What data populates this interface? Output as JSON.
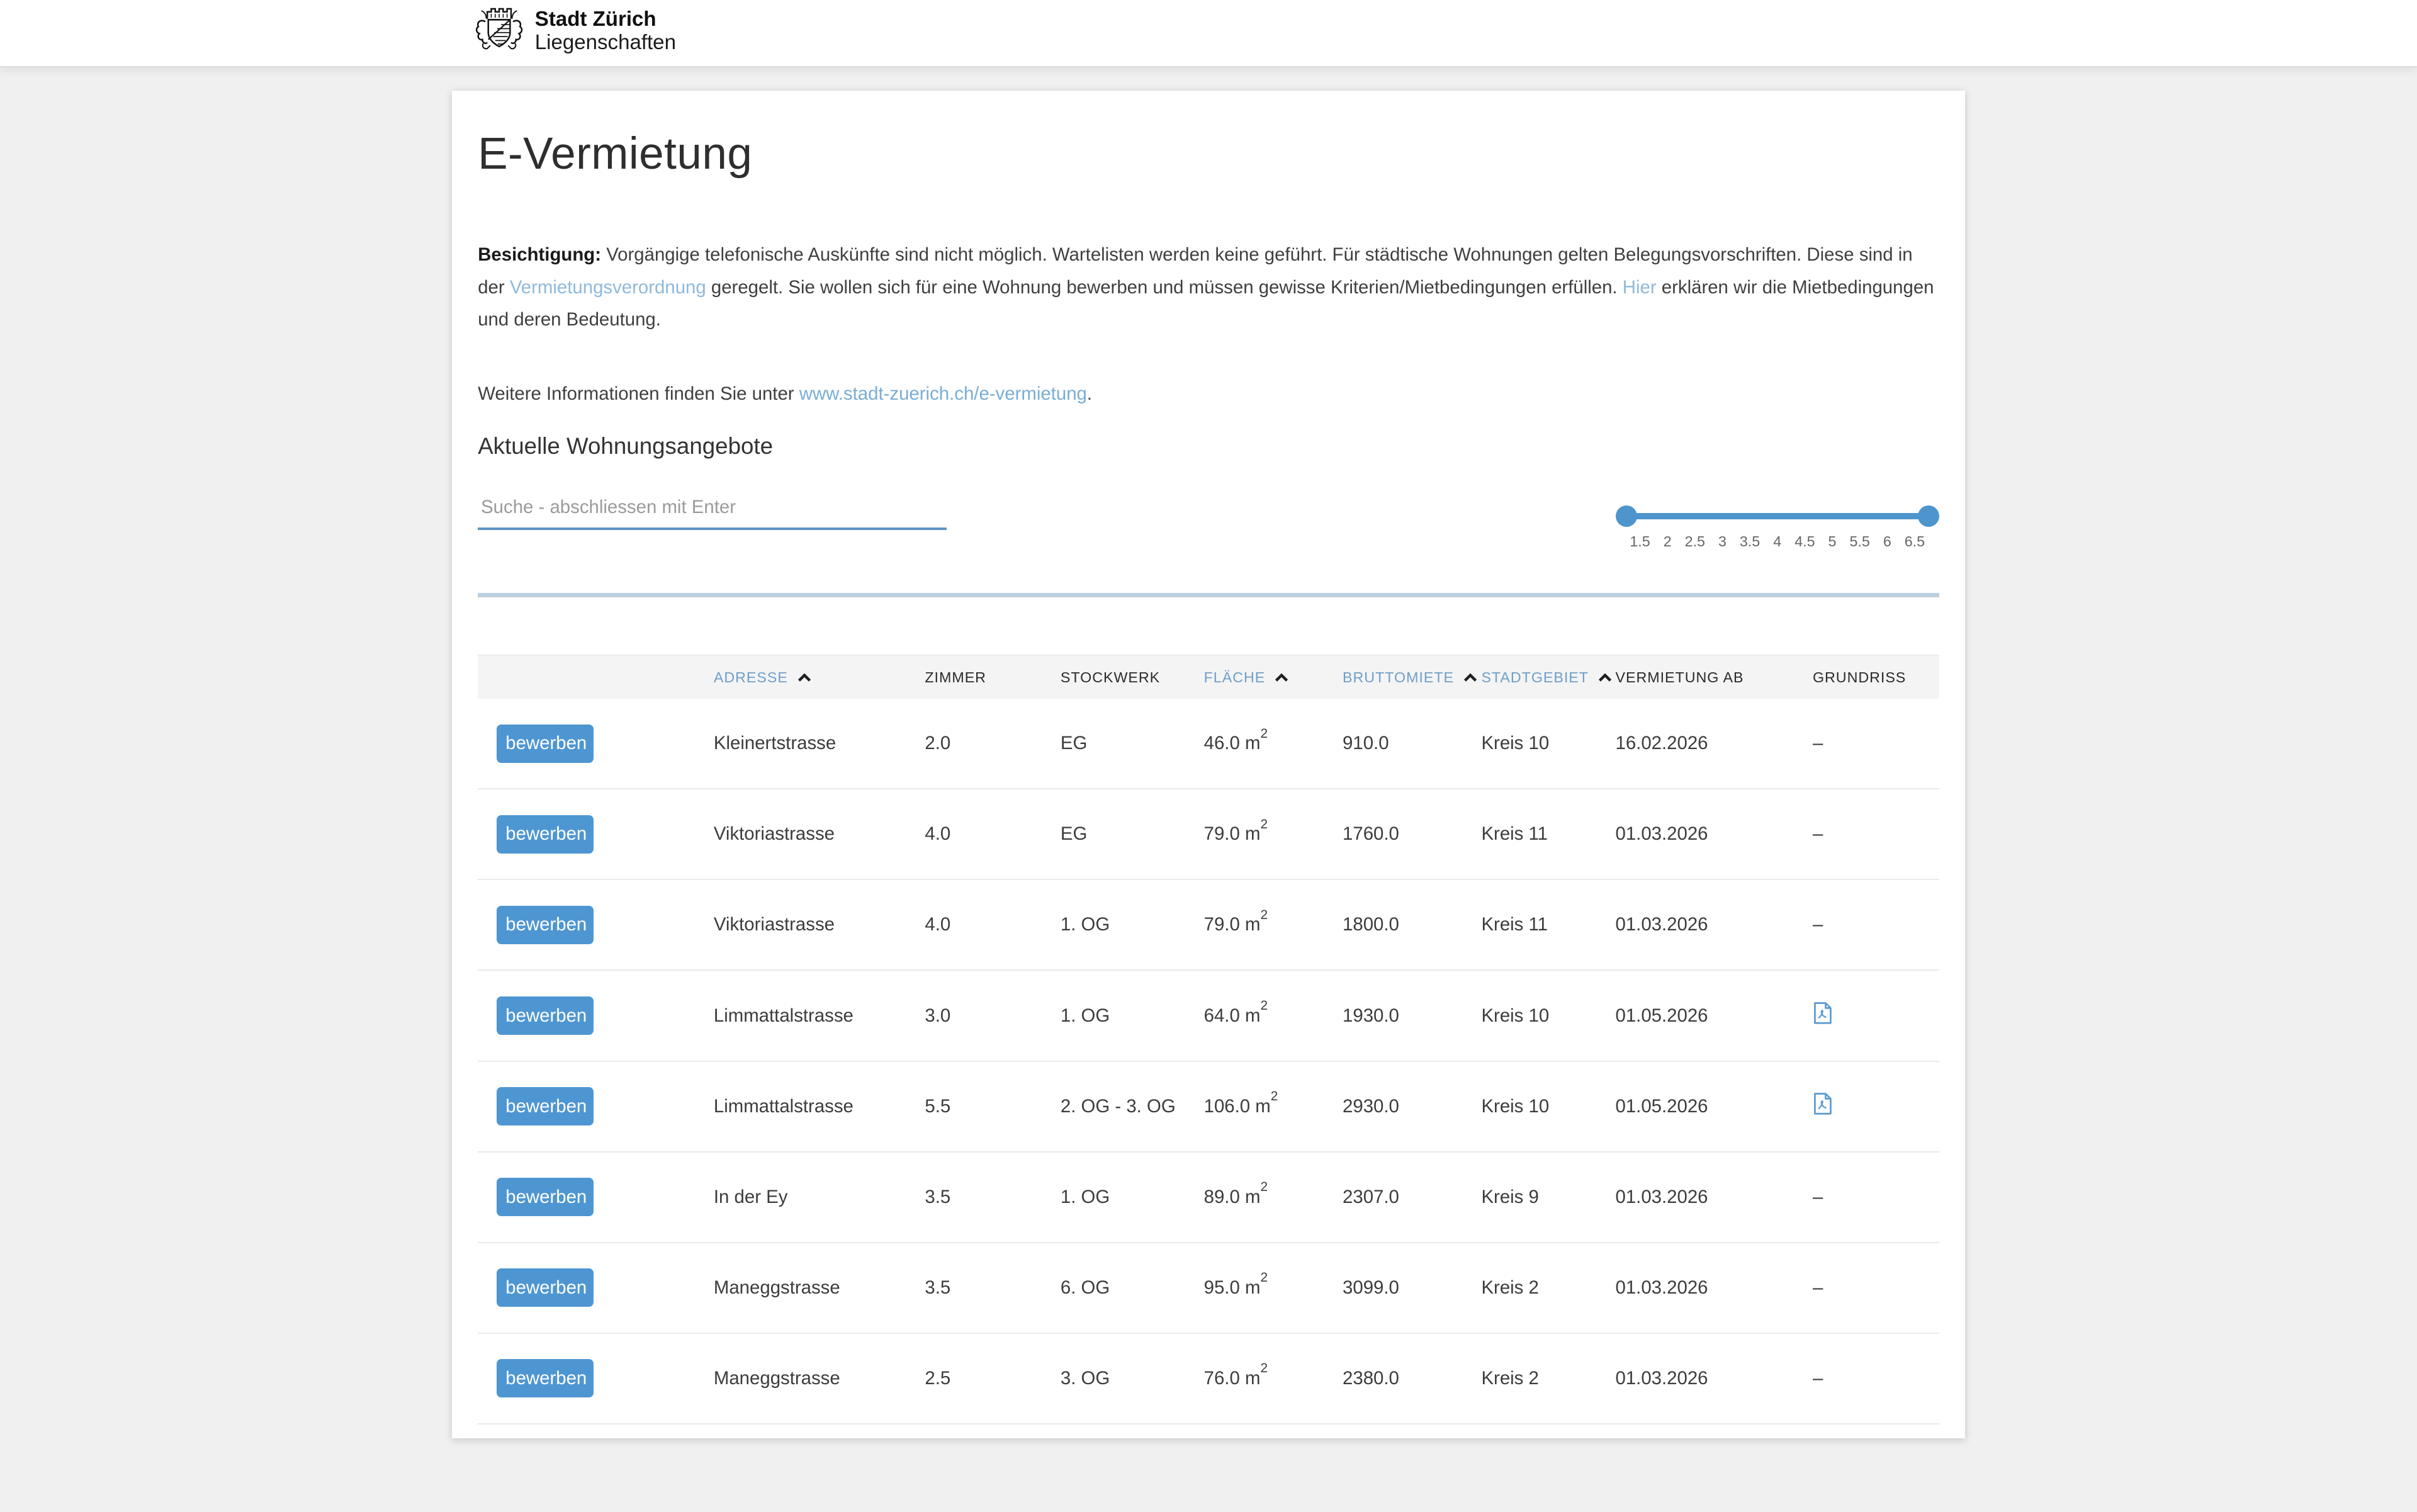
{
  "header": {
    "brand_title": "Stadt Zürich",
    "brand_subtitle": "Liegenschaften"
  },
  "page": {
    "title": "E-Vermietung",
    "intro": {
      "label": "Besichtigung:",
      "text_1": " Vorgängige telefonische Auskünfte sind nicht möglich. Wartelisten werden keine geführt. Für städtische Wohnungen gelten Belegungsvorschriften. Diese sind in der ",
      "link_1": "Vermietungsverordnung",
      "text_2": " geregelt. Sie wollen sich für eine Wohnung bewerben und müssen gewisse Kriterien/Mietbedingungen erfüllen. ",
      "link_2": "Hier",
      "text_3": " erklären wir die Mietbedingungen und deren Bedeutung."
    },
    "more_info": {
      "text": "Weitere Informationen finden Sie unter ",
      "link": "www.stadt-zuerich.ch/e-vermietung",
      "suffix": "."
    },
    "section_title": "Aktuelle Wohnungsangebote",
    "search_placeholder": "Suche - abschliessen mit Enter",
    "slider": {
      "min_value": "1.5",
      "max_value": "6.5",
      "labels": [
        "1.5",
        "2",
        "2.5",
        "3",
        "3.5",
        "4",
        "4.5",
        "5",
        "5.5",
        "6",
        "6.5"
      ]
    }
  },
  "table": {
    "apply_label": "bewerben",
    "columns": [
      {
        "label": "ADRESSE",
        "sortable": true
      },
      {
        "label": "ZIMMER",
        "sortable": false
      },
      {
        "label": "STOCKWERK",
        "sortable": false
      },
      {
        "label": "FLÄCHE",
        "sortable": true
      },
      {
        "label": "BRUTTOMIETE",
        "sortable": true
      },
      {
        "label": "STADTGEBIET",
        "sortable": true
      },
      {
        "label": "VERMIETUNG AB",
        "sortable": false
      },
      {
        "label": "GRUNDRISS",
        "sortable": false
      }
    ],
    "rows": [
      {
        "adresse": "Kleinertstrasse",
        "zimmer": "2.0",
        "stockwerk": "EG",
        "flaeche": "46.0 m²",
        "bruttomiete": "910.0",
        "stadtgebiet": "Kreis 10",
        "vermietung_ab": "16.02.2026",
        "grundriss": "–"
      },
      {
        "adresse": "Viktoriastrasse",
        "zimmer": "4.0",
        "stockwerk": "EG",
        "flaeche": "79.0 m²",
        "bruttomiete": "1760.0",
        "stadtgebiet": "Kreis 11",
        "vermietung_ab": "01.03.2026",
        "grundriss": "–"
      },
      {
        "adresse": "Viktoriastrasse",
        "zimmer": "4.0",
        "stockwerk": "1. OG",
        "flaeche": "79.0 m²",
        "bruttomiete": "1800.0",
        "stadtgebiet": "Kreis 11",
        "vermietung_ab": "01.03.2026",
        "grundriss": "–"
      },
      {
        "adresse": "Limmattalstrasse",
        "zimmer": "3.0",
        "stockwerk": "1. OG",
        "flaeche": "64.0 m²",
        "bruttomiete": "1930.0",
        "stadtgebiet": "Kreis 10",
        "vermietung_ab": "01.05.2026",
        "grundriss": "pdf"
      },
      {
        "adresse": "Limmattalstrasse",
        "zimmer": "5.5",
        "stockwerk": "2. OG - 3. OG",
        "flaeche": "106.0 m²",
        "bruttomiete": "2930.0",
        "stadtgebiet": "Kreis 10",
        "vermietung_ab": "01.05.2026",
        "grundriss": "pdf"
      },
      {
        "adresse": "In der Ey",
        "zimmer": "3.5",
        "stockwerk": "1. OG",
        "flaeche": "89.0 m²",
        "bruttomiete": "2307.0",
        "stadtgebiet": "Kreis 9",
        "vermietung_ab": "01.03.2026",
        "grundriss": "–"
      },
      {
        "adresse": "Maneggstrasse",
        "zimmer": "3.5",
        "stockwerk": "6. OG",
        "flaeche": "95.0 m²",
        "bruttomiete": "3099.0",
        "stadtgebiet": "Kreis 2",
        "vermietung_ab": "01.03.2026",
        "grundriss": "–"
      },
      {
        "adresse": "Maneggstrasse",
        "zimmer": "2.5",
        "stockwerk": "3. OG",
        "flaeche": "76.0 m²",
        "bruttomiete": "2380.0",
        "stadtgebiet": "Kreis 2",
        "vermietung_ab": "01.03.2026",
        "grundriss": "–"
      }
    ]
  },
  "colors": {
    "accent_blue": "#4e96d2",
    "slider_blue": "#4e95cd",
    "input_underline_blue": "#5b94c2",
    "link_light_blue": "#8fb9dd",
    "link_url_blue": "#79add5",
    "sort_header_blue": "#6f9fc9",
    "divider_blue": "#b9d0e3",
    "page_background": "#f0f0f0",
    "pdf_icon_blue": "#5b9bd1"
  }
}
